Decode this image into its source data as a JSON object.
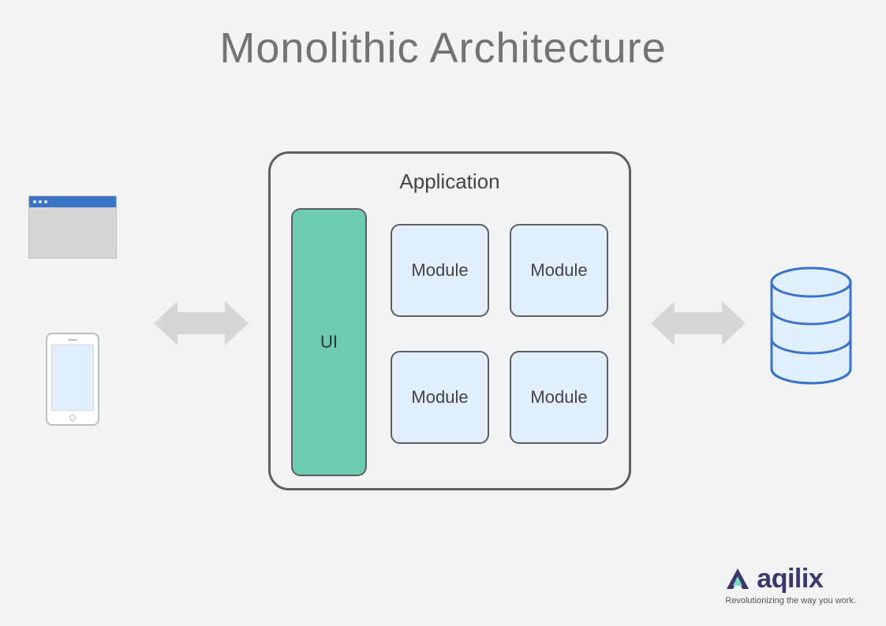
{
  "title": "Monolithic Architecture",
  "application": {
    "label": "Application",
    "ui_label": "UI",
    "modules": [
      "Module",
      "Module",
      "Module",
      "Module"
    ]
  },
  "clients": {
    "browser": "browser-window",
    "phone": "mobile-device"
  },
  "database": "database",
  "logo": {
    "name": "aqilix",
    "tagline": "Revolutionizing the way you work."
  }
}
